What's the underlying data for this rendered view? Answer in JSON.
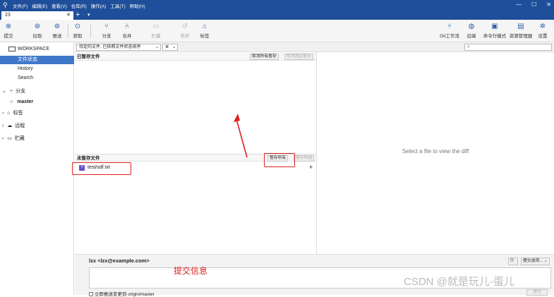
{
  "titlebar": {
    "menus": [
      "文件(F)",
      "编辑(E)",
      "查看(V)",
      "仓库(R)",
      "操作(A)",
      "工具(T)",
      "帮助(H)"
    ],
    "win_buttons": [
      "—",
      "☐",
      "✕"
    ]
  },
  "tab": {
    "name": "23",
    "close": "✕",
    "add": "+",
    "more": "▾"
  },
  "toolbar": {
    "commit": "提交",
    "pull": "拉取",
    "push": "推送",
    "fetch": "获取",
    "branch": "分支",
    "merge": "合并",
    "stash": "贮藏",
    "discard": "丢弃",
    "tag": "标签",
    "git_flow": "Git工作流",
    "remote": "远端",
    "terminal": "命令行模式",
    "explorer": "资源管理器",
    "settings": "设置"
  },
  "sidebar": {
    "workspace": "WORKSPACE",
    "file_status": "文件状态",
    "history": "History",
    "search": "Search",
    "branches": "分支",
    "current_branch": "master",
    "tags": "标签",
    "remotes": "远程",
    "stashes": "贮藏"
  },
  "filter": {
    "sort_option": "待定的文件, 已依照文件状态排序",
    "view_option": "≣",
    "search_placeholder": ""
  },
  "staged": {
    "title": "已暂存文件",
    "unstage_all": "取消所有暂存",
    "unstage_selected": "取消选定暂存"
  },
  "unstaged": {
    "title": "未暂存文件",
    "stage_all": "暂存所有",
    "stage_selected": "暂存所选",
    "files": [
      {
        "name": "test/sdf.txt",
        "status_icon": "?"
      }
    ]
  },
  "diff": {
    "placeholder": "Select a file to view the diff"
  },
  "commit": {
    "author": "lzx <lzx@example.com>",
    "message_annotation": "提交信息",
    "push_immediately": "立即推送变更到 origin/master",
    "options": "提交选项...",
    "submit": "提交"
  },
  "watermark": "CSDN @就是玩儿-蛋儿",
  "colors": {
    "titlebar": "#1f4f9a",
    "selection": "#3f78c8",
    "annotation": "#e02020"
  }
}
